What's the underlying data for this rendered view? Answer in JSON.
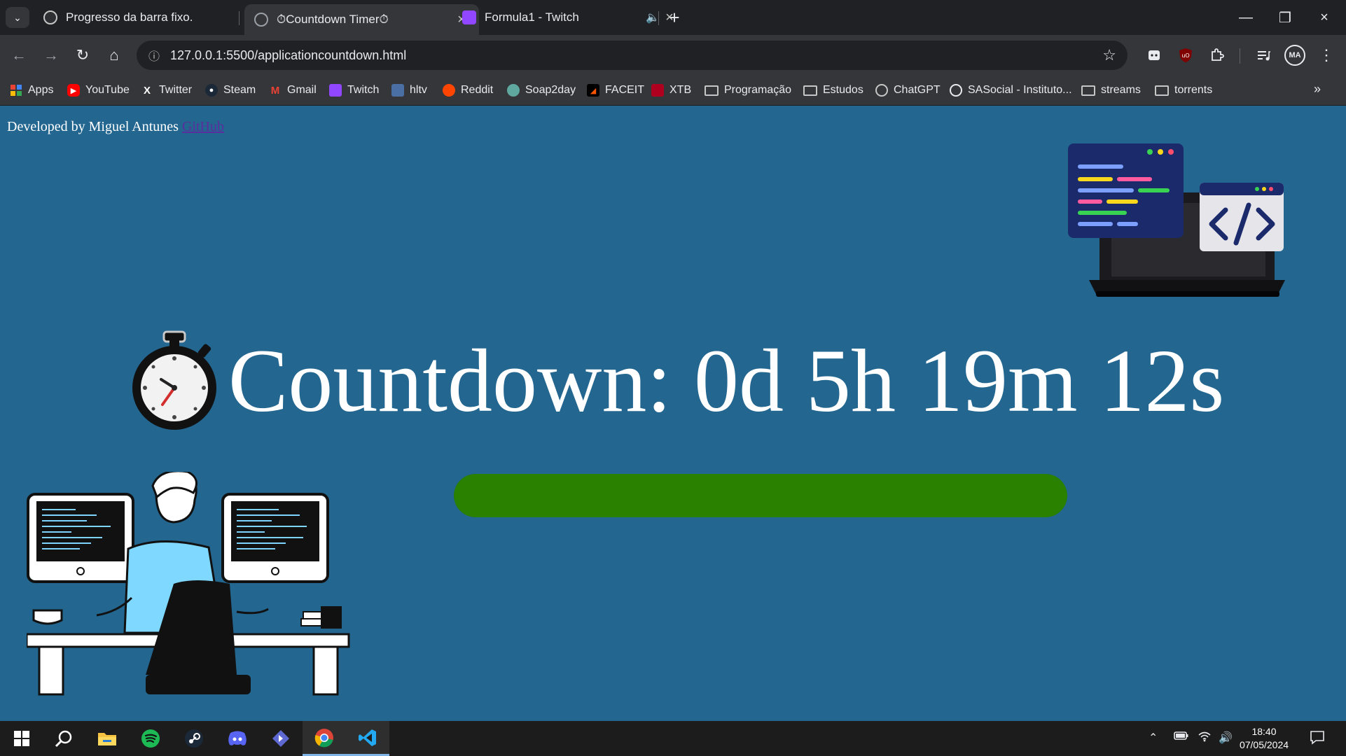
{
  "browser": {
    "tabs": [
      {
        "title": "Progresso da barra fixo.",
        "favicon": "chatgpt-icon"
      },
      {
        "title": "⏱Countdown Timer⏱",
        "favicon": "globe-icon",
        "active": true
      },
      {
        "title": "Formula1 - Twitch",
        "favicon": "twitch-icon",
        "audio": true
      }
    ],
    "url": "127.0.0.1:5500/applicationcountdown.html",
    "profile_initials": "MA",
    "bookmarks": [
      {
        "label": "Apps",
        "icon": "apps-icon"
      },
      {
        "label": "YouTube",
        "icon": "youtube-icon"
      },
      {
        "label": "Twitter",
        "icon": "x-icon"
      },
      {
        "label": "Steam",
        "icon": "steam-icon"
      },
      {
        "label": "Gmail",
        "icon": "gmail-icon"
      },
      {
        "label": "Twitch",
        "icon": "twitch-icon"
      },
      {
        "label": "hltv",
        "icon": "hltv-icon"
      },
      {
        "label": "Reddit",
        "icon": "reddit-icon"
      },
      {
        "label": "Soap2day",
        "icon": "soap2day-icon"
      },
      {
        "label": "FACEIT",
        "icon": "faceit-icon"
      },
      {
        "label": "XTB",
        "icon": "xtb-icon"
      },
      {
        "label": "Programação",
        "icon": "folder-icon"
      },
      {
        "label": "Estudos",
        "icon": "folder-icon"
      },
      {
        "label": "ChatGPT",
        "icon": "chatgpt-icon"
      },
      {
        "label": "SASocial - Instituto...",
        "icon": "sasocial-icon"
      },
      {
        "label": "streams",
        "icon": "folder-icon"
      },
      {
        "label": "torrents",
        "icon": "folder-icon"
      }
    ]
  },
  "page": {
    "credit_text": "Developed by Miguel Antunes",
    "credit_link": "GitHub",
    "countdown_label": "Countdown: 0d 5h 19m 12s",
    "progress_fraction": 1.0,
    "colors": {
      "background": "#236690",
      "progress": "#2a8100",
      "text": "#ffffff"
    }
  },
  "taskbar": {
    "apps": [
      "windows-start-icon",
      "search-icon",
      "file-explorer-icon",
      "spotify-icon",
      "steam-icon",
      "discord-icon",
      "linear-icon",
      "chrome-icon",
      "vscode-icon"
    ],
    "time": "18:40",
    "date": "07/05/2024"
  }
}
